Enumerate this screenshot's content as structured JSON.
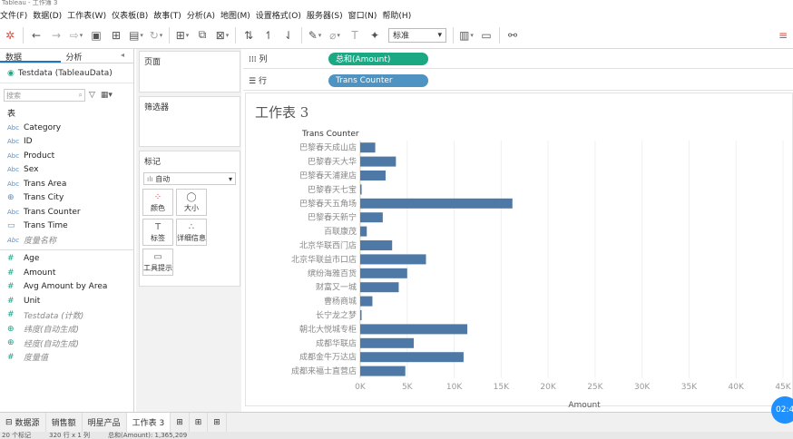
{
  "window": {
    "title": "Tableau - 工作簿 3"
  },
  "menu": [
    "文件(F)",
    "数据(D)",
    "工作表(W)",
    "仪表板(B)",
    "故事(T)",
    "分析(A)",
    "地图(M)",
    "设置格式(O)",
    "服务器(S)",
    "窗口(N)",
    "帮助(H)"
  ],
  "toolbar": {
    "fit_select": "标准"
  },
  "left_pane": {
    "tab_data": "数据",
    "tab_analysis": "分析",
    "datasource": "Testdata (TableauData)",
    "search_placeholder": "搜索",
    "dimensions_header": "表",
    "dimensions": [
      {
        "name": "Category",
        "icon": "Abc"
      },
      {
        "name": "ID",
        "icon": "Abc"
      },
      {
        "name": "Product",
        "icon": "Abc"
      },
      {
        "name": "Sex",
        "icon": "Abc"
      },
      {
        "name": "Trans Area",
        "icon": "Abc"
      },
      {
        "name": "Trans City",
        "icon": "globe-icon"
      },
      {
        "name": "Trans Counter",
        "icon": "Abc"
      },
      {
        "name": "Trans Time",
        "icon": "calendar-icon"
      },
      {
        "name": "度量名称",
        "icon": "Abc"
      }
    ],
    "measures": [
      {
        "name": "Age"
      },
      {
        "name": "Amount"
      },
      {
        "name": "Avg Amount by Area"
      },
      {
        "name": "Unit"
      },
      {
        "name": "Testdata (计数)"
      },
      {
        "name": "纬度(自动生成)"
      },
      {
        "name": "经度(自动生成)"
      },
      {
        "name": "度量值"
      }
    ]
  },
  "cards": {
    "pages": "页面",
    "filters": "筛选器",
    "marks": "标记",
    "marks_type": "自动",
    "mark_buttons": [
      "颜色",
      "大小",
      "标签",
      "详细信息",
      "工具提示"
    ]
  },
  "shelves": {
    "columns_label": "列",
    "columns_pill": "总和(Amount)",
    "rows_label": "行",
    "rows_pill": "Trans Counter"
  },
  "sheet_title": "工作表 3",
  "chart_data": {
    "type": "bar",
    "orientation": "horizontal",
    "row_header": "Trans Counter",
    "xlabel": "Amount",
    "xlim": [
      0,
      45000
    ],
    "xticks": [
      "0K",
      "5K",
      "10K",
      "15K",
      "20K",
      "25K",
      "30K",
      "35K",
      "40K",
      "45K"
    ],
    "tick_values": [
      0,
      5000,
      10000,
      15000,
      20000,
      25000,
      30000,
      35000,
      40000,
      45000
    ],
    "color": "#4e79a7",
    "categories": [
      "巴黎春天成山店",
      "巴黎春天大华",
      "巴黎春天浦建店",
      "巴黎春天七宝",
      "巴黎春天五角场",
      "巴黎春天新宁",
      "百联康茂",
      "北京华联西门店",
      "北京华联益市口店",
      "缤纷海雅百货",
      "财富又一城",
      "曹杨商城",
      "长宁龙之梦",
      "朝北大悦城专柜",
      "成都华联店",
      "成都金牛万达店",
      "成都来福士直营店"
    ],
    "values": [
      1600,
      3800,
      2700,
      150,
      16200,
      2400,
      700,
      3400,
      7000,
      5000,
      4100,
      1300,
      120,
      11400,
      5700,
      11000,
      4800
    ]
  },
  "bottom_tabs": {
    "datasource": "数据源",
    "sheets": [
      "销售额",
      "明星产品",
      "工作表 3"
    ],
    "active": "工作表 3"
  },
  "status": {
    "marks": "20 个标记",
    "rows_cols": "320 行 x 1 列",
    "sum": "总和(Amount): 1,365,209"
  },
  "timer": "02:4"
}
